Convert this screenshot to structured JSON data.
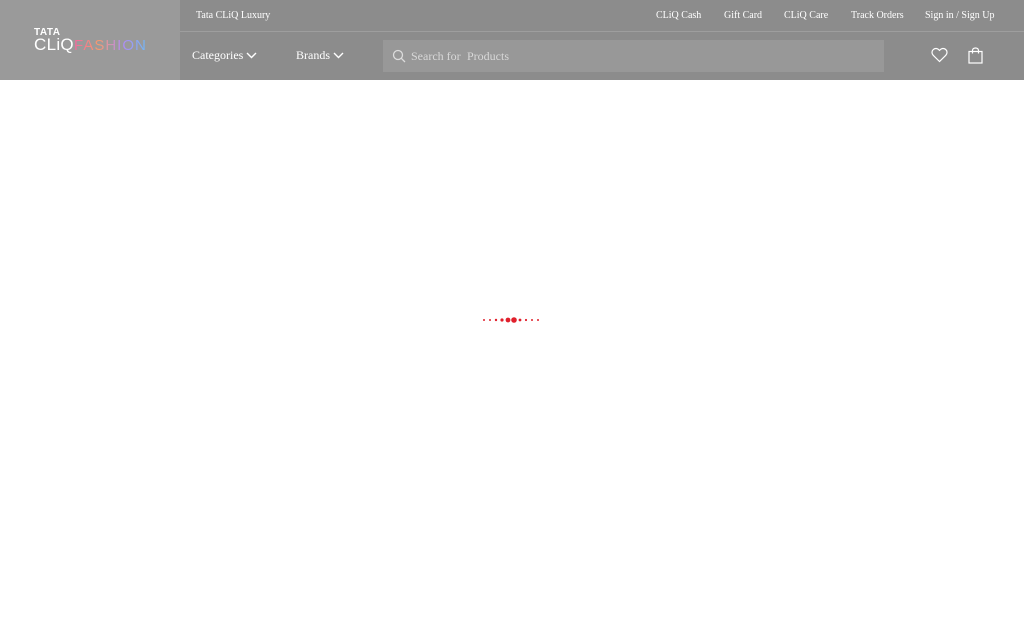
{
  "logo": {
    "tata": "TATA",
    "cliq": "CLiQ",
    "fashion": "FASHION"
  },
  "topbar": {
    "luxury": "Tata CLiQ Luxury",
    "cliq_cash": "CLiQ Cash",
    "gift_card": "Gift Card",
    "cliq_care": "CLiQ Care",
    "track_orders": "Track Orders",
    "sign_in": "Sign in / Sign Up"
  },
  "nav": {
    "categories": "Categories",
    "brands": "Brands"
  },
  "search": {
    "prefix": "Search for",
    "placeholder": "Products"
  },
  "icons": {
    "search": "search-icon",
    "wishlist": "heart-icon",
    "bag": "shopping-bag-icon",
    "chevron": "chevron-down-icon",
    "loader": "loading-dots"
  },
  "colors": {
    "header": "#8c8c8c",
    "loader": "#e0202c",
    "text": "#ffffff"
  }
}
